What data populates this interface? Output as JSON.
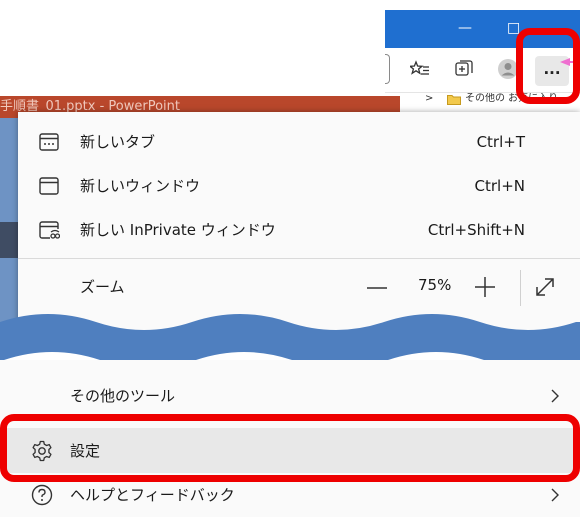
{
  "browser": {
    "minimize_glyph": "—",
    "maximize_glyph": "□",
    "more_label": "...",
    "favorites_folder_label": "その他の お気に入り",
    "favorites_chevron": ">"
  },
  "background": {
    "powerpoint_title": "手順書_01.pptx - PowerPoint"
  },
  "menu": {
    "items": [
      {
        "label": "新しいタブ",
        "shortcut": "Ctrl+T",
        "icon": "new-tab-icon"
      },
      {
        "label": "新しいウィンドウ",
        "shortcut": "Ctrl+N",
        "icon": "new-window-icon"
      },
      {
        "label": "新しい InPrivate ウィンドウ",
        "shortcut": "Ctrl+Shift+N",
        "icon": "inprivate-icon"
      }
    ],
    "zoom": {
      "label": "ズーム",
      "value": "75%"
    },
    "more_tools": {
      "label": "その他のツール"
    },
    "settings": {
      "label": "設定",
      "icon": "gear-icon"
    },
    "help": {
      "label": "ヘルプとフィードバック",
      "icon": "help-icon"
    }
  },
  "colors": {
    "highlight": "#ee0000",
    "wave": "#4f7fbf",
    "titlebar": "#1f6fd0"
  }
}
